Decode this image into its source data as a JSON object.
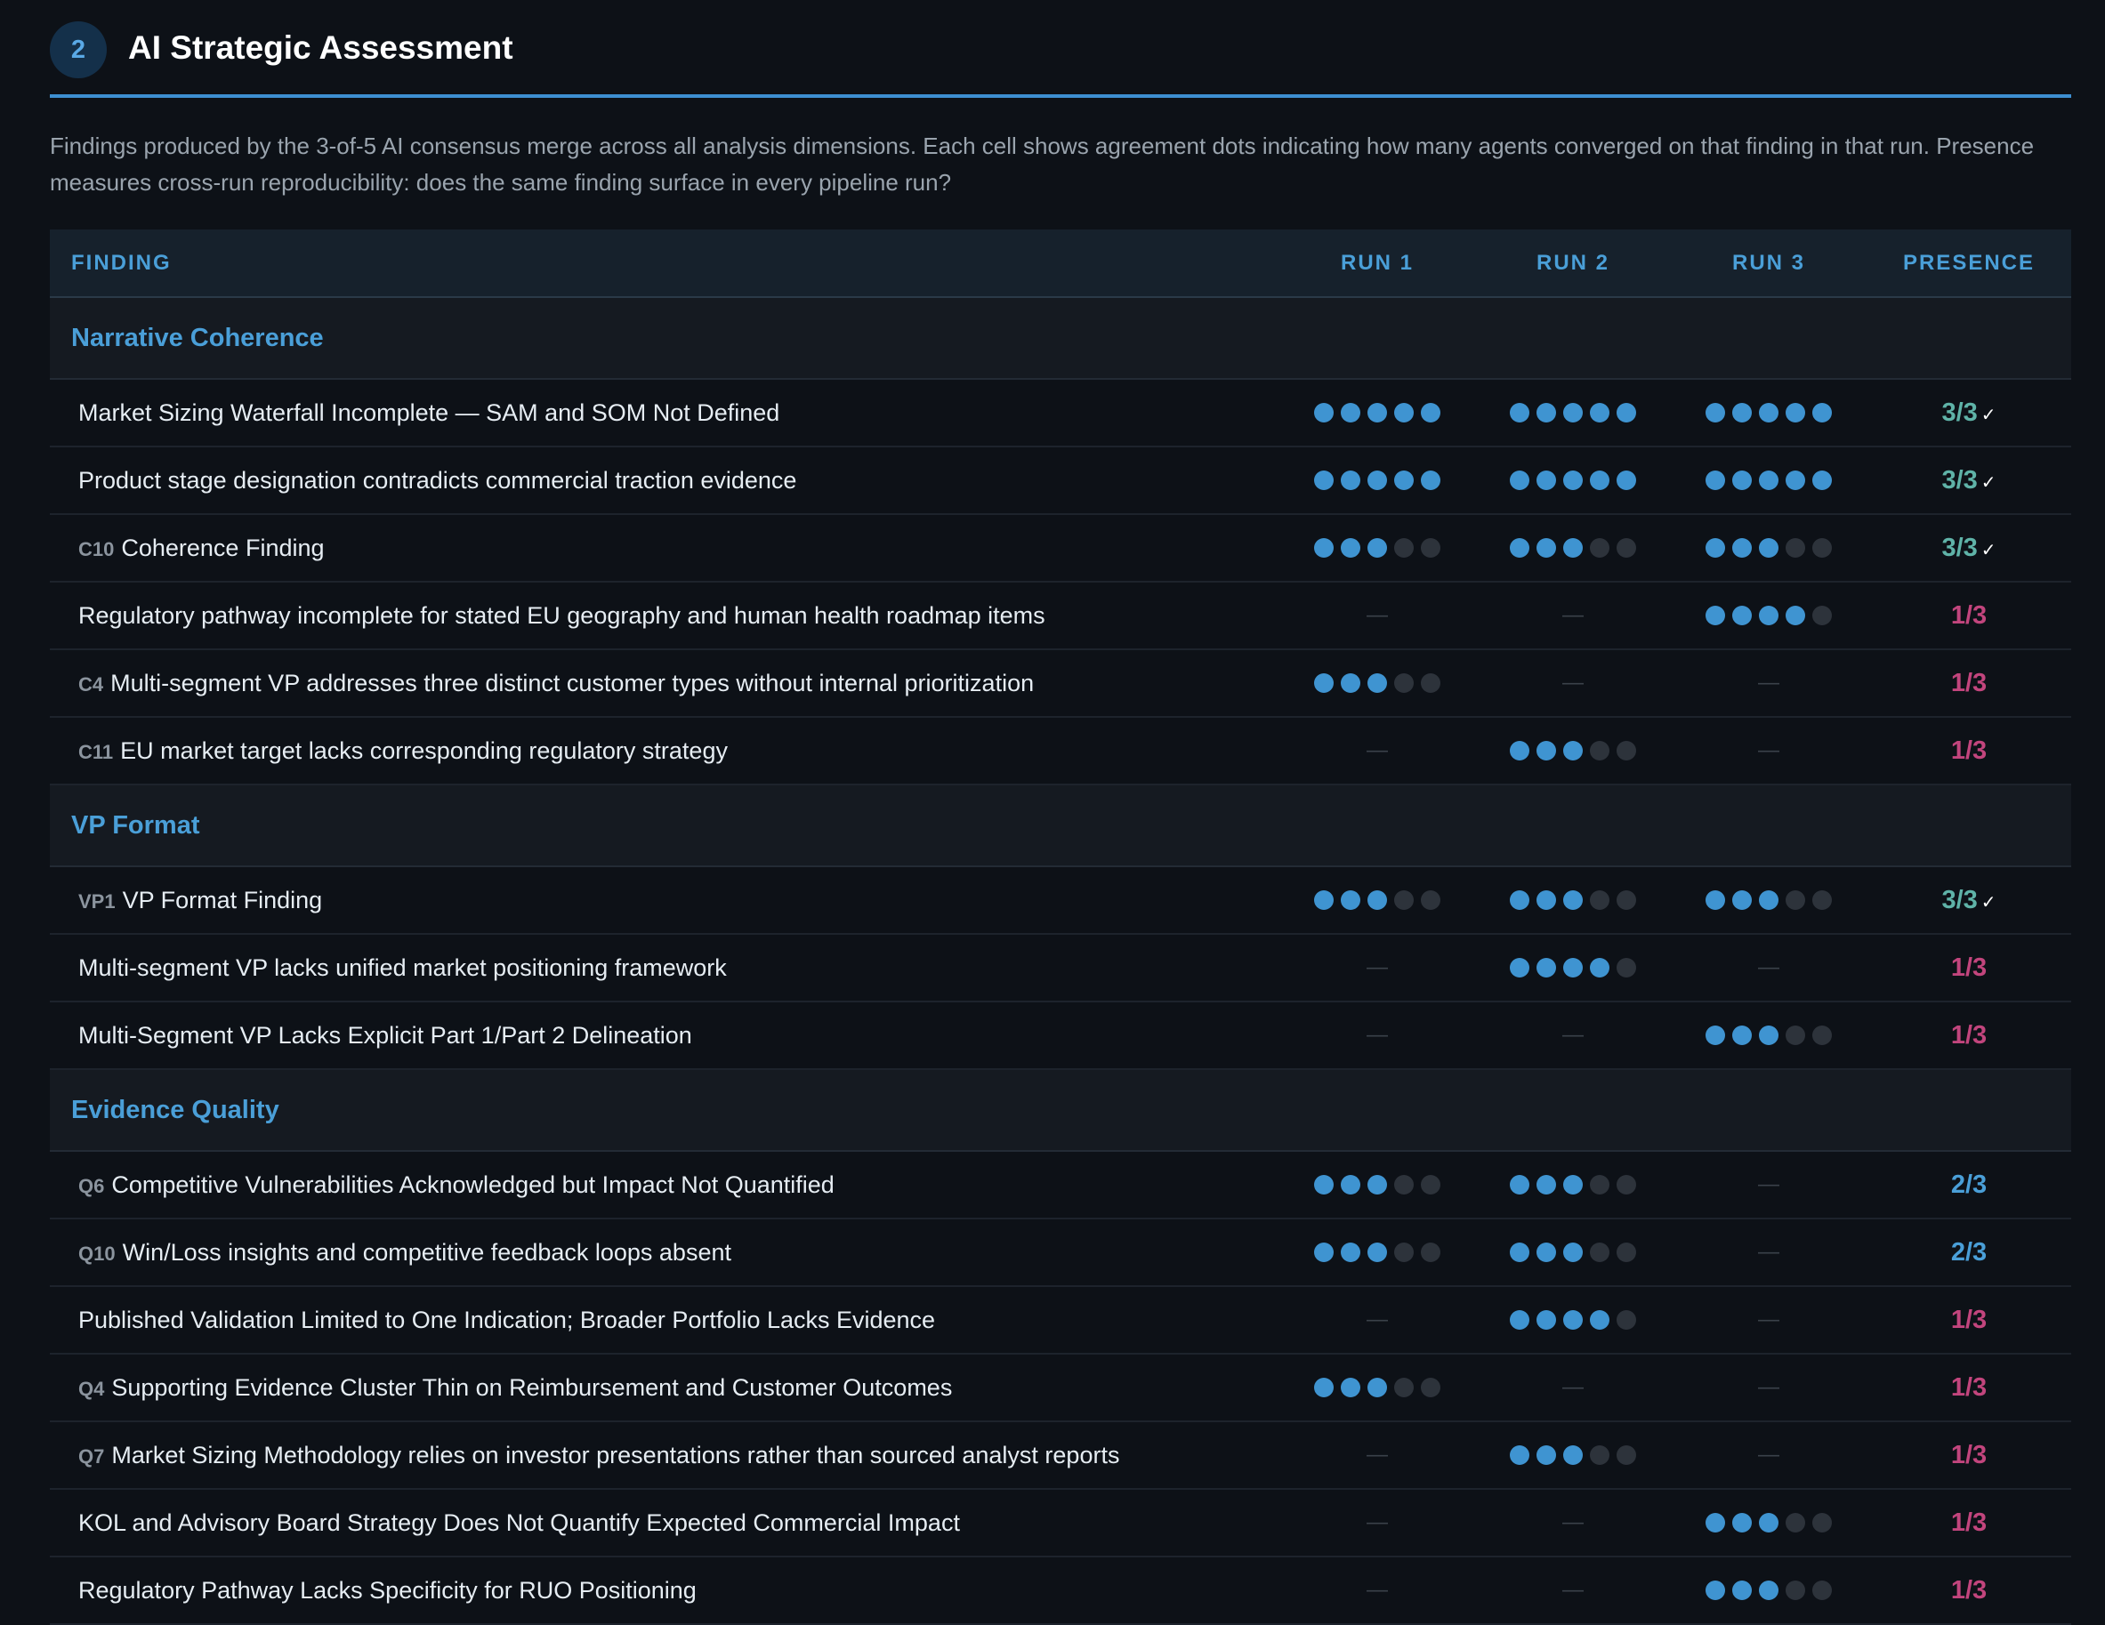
{
  "section": {
    "number": "2",
    "title": "AI Strategic Assessment",
    "description": "Findings produced by the 3-of-5 AI consensus merge across all analysis dimensions. Each cell shows agreement dots indicating how many agents converged on that finding in that run. Presence measures cross-run reproducibility: does the same finding surface in every pipeline run?"
  },
  "table": {
    "headers": [
      "FINDING",
      "RUN 1",
      "RUN 2",
      "RUN 3",
      "PRESENCE"
    ],
    "dots_per_run": 5,
    "dash": "—",
    "check": "✓",
    "groups": [
      {
        "name": "Narrative Coherence",
        "rows": [
          {
            "code": "",
            "text": "Market Sizing Waterfall Incomplete — SAM and SOM Not Defined",
            "runs": [
              5,
              5,
              5
            ],
            "presence": "3/3",
            "status": "full"
          },
          {
            "code": "",
            "text": "Product stage designation contradicts commercial traction evidence",
            "runs": [
              5,
              5,
              5
            ],
            "presence": "3/3",
            "status": "full"
          },
          {
            "code": "C10",
            "text": "Coherence Finding",
            "runs": [
              3,
              3,
              3
            ],
            "presence": "3/3",
            "status": "full"
          },
          {
            "code": "",
            "text": "Regulatory pathway incomplete for stated EU geography and human health roadmap items",
            "runs": [
              null,
              null,
              4
            ],
            "presence": "1/3",
            "status": "one"
          },
          {
            "code": "C4",
            "text": "Multi-segment VP addresses three distinct customer types without internal prioritization",
            "runs": [
              3,
              null,
              null
            ],
            "presence": "1/3",
            "status": "one"
          },
          {
            "code": "C11",
            "text": "EU market target lacks corresponding regulatory strategy",
            "runs": [
              null,
              3,
              null
            ],
            "presence": "1/3",
            "status": "one"
          }
        ]
      },
      {
        "name": "VP Format",
        "rows": [
          {
            "code": "VP1",
            "text": "VP Format Finding",
            "runs": [
              3,
              3,
              3
            ],
            "presence": "3/3",
            "status": "full"
          },
          {
            "code": "",
            "text": "Multi-segment VP lacks unified market positioning framework",
            "runs": [
              null,
              4,
              null
            ],
            "presence": "1/3",
            "status": "one"
          },
          {
            "code": "",
            "text": "Multi-Segment VP Lacks Explicit Part 1/Part 2 Delineation",
            "runs": [
              null,
              null,
              3
            ],
            "presence": "1/3",
            "status": "one"
          }
        ]
      },
      {
        "name": "Evidence Quality",
        "rows": [
          {
            "code": "Q6",
            "text": "Competitive Vulnerabilities Acknowledged but Impact Not Quantified",
            "runs": [
              3,
              3,
              null
            ],
            "presence": "2/3",
            "status": "two"
          },
          {
            "code": "Q10",
            "text": "Win/Loss insights and competitive feedback loops absent",
            "runs": [
              3,
              3,
              null
            ],
            "presence": "2/3",
            "status": "two"
          },
          {
            "code": "",
            "text": "Published Validation Limited to One Indication; Broader Portfolio Lacks Evidence",
            "runs": [
              null,
              4,
              null
            ],
            "presence": "1/3",
            "status": "one"
          },
          {
            "code": "Q4",
            "text": "Supporting Evidence Cluster Thin on Reimbursement and Customer Outcomes",
            "runs": [
              3,
              null,
              null
            ],
            "presence": "1/3",
            "status": "one"
          },
          {
            "code": "Q7",
            "text": "Market Sizing Methodology relies on investor presentations rather than sourced analyst reports",
            "runs": [
              null,
              3,
              null
            ],
            "presence": "1/3",
            "status": "one"
          },
          {
            "code": "",
            "text": "KOL and Advisory Board Strategy Does Not Quantify Expected Commercial Impact",
            "runs": [
              null,
              null,
              3
            ],
            "presence": "1/3",
            "status": "one"
          },
          {
            "code": "",
            "text": "Regulatory Pathway Lacks Specificity for RUO Positioning",
            "runs": [
              null,
              null,
              3
            ],
            "presence": "1/3",
            "status": "one"
          }
        ]
      }
    ]
  }
}
